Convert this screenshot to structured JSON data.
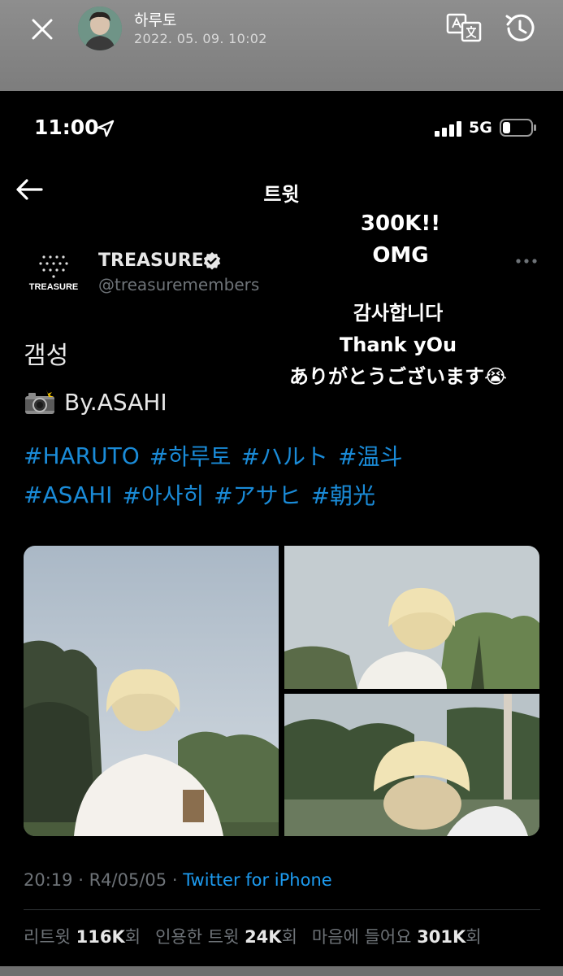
{
  "viewer": {
    "name": "하루토",
    "date": "2022. 05. 09. 10:02",
    "icons": [
      "close-icon",
      "translate-icon",
      "history-icon"
    ]
  },
  "status_bar": {
    "time": "11:00",
    "network": "5G"
  },
  "header": {
    "title": "트윗"
  },
  "overlay": {
    "line1": "300K!!",
    "line2": "OMG",
    "line3": "감사합니다",
    "line4": "Thank yOu",
    "line5": "ありがとうございます😭"
  },
  "tweet": {
    "author_name": "TREASURE",
    "author_handle": "@treasuremembers",
    "logo_text": "TREASURE",
    "text_line1": "갬성",
    "text_line2": "By.ASAHI",
    "hashtags_row1": [
      "#HARUTO",
      "#하루토",
      "#ハルト",
      "#温斗"
    ],
    "hashtags_row2": [
      "#ASAHI",
      "#아사히",
      "#アサヒ",
      "#朝光"
    ],
    "time": "20:19",
    "date": "R4/05/05",
    "separator": "·",
    "source": "Twitter for iPhone"
  },
  "stats": {
    "retweets_label": "리트윗",
    "retweets_value": "116K",
    "retweets_unit": "회",
    "quotes_label": "인용한 트윗",
    "quotes_value": "24K",
    "quotes_unit": "회",
    "likes_label": "마음에 들어요",
    "likes_value": "301K",
    "likes_unit": "회"
  },
  "colors": {
    "link": "#1d9bf0",
    "background": "#000000",
    "viewer_bar": "#868686"
  }
}
